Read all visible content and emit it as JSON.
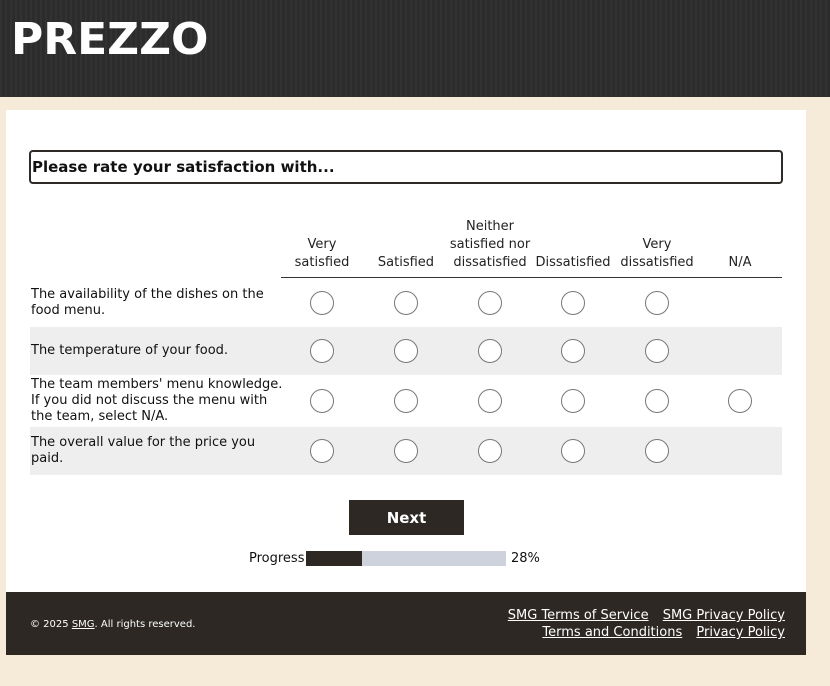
{
  "brand": {
    "logo_text": "PREZZO"
  },
  "survey": {
    "question": "Please rate your satisfaction with...",
    "columns": [
      {
        "label": "Very satisfied"
      },
      {
        "label": "Satisfied"
      },
      {
        "label": "Neither satisfied nor dissatisfied"
      },
      {
        "label": "Dissatisfied"
      },
      {
        "label": "Very dissatisfied"
      },
      {
        "label": "N/A"
      }
    ],
    "rows": [
      {
        "label": "The availability of the dishes on the food menu."
      },
      {
        "label": "The temperature of your food."
      },
      {
        "label": "The team members' menu knowledge. If you did not discuss the menu with the team, select N/A."
      },
      {
        "label": "The overall value for the price you paid."
      }
    ]
  },
  "navigation": {
    "next_label": "Next"
  },
  "progress": {
    "label": "Progress",
    "percent_text": "28%",
    "value": 0.28
  },
  "footer": {
    "copyright_prefix": "© 2025 ",
    "copyright_smg": "SMG",
    "copyright_suffix": ". All rights reserved.",
    "links": {
      "smg_terms": "SMG Terms of Service",
      "smg_privacy": "SMG Privacy Policy",
      "terms": "Terms and Conditions",
      "privacy": "Privacy Policy"
    }
  },
  "colors": {
    "page_background": "#f6ead8",
    "header_background": "#2e2e2e",
    "accent_dark": "#2d2824",
    "progress_track": "#cdd2dc",
    "row_alt": "#eeeeee"
  }
}
